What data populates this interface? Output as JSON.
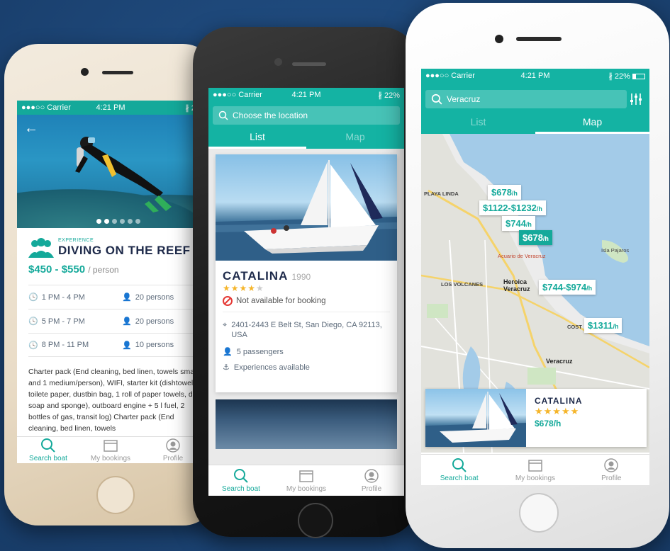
{
  "colors": {
    "accent": "#14b3a3",
    "title": "#1e2a4a",
    "star": "#f5b52a",
    "background": "#1d4677"
  },
  "status": {
    "carrier": "●●●○○ Carrier",
    "time": "4:21 PM",
    "battery": "22%",
    "battery_cut": "22"
  },
  "tabbar": {
    "search": "Search boat",
    "bookings": "My bookings",
    "profile": "Profile"
  },
  "phone1": {
    "experience_label": "EXPERIENCE",
    "title": "DIVING ON THE REEF",
    "price": "$450 - $550",
    "price_unit": "/ person",
    "schedule": [
      {
        "time": "1 PM - 4 PM",
        "persons": "20 persons"
      },
      {
        "time": "5 PM - 7 PM",
        "persons": "20 persons"
      },
      {
        "time": "8 PM - 11 PM",
        "persons": "10 persons"
      }
    ],
    "description": "Charter pack (End cleaning, bed linen, towels small and 1 medium/person), WIFI, starter kit (dishtowel, toilete paper, dustbin bag, 1 roll of paper towels, dish soap and sponge), outboard engine + 5 l fuel, 2 bottles of gas, transit log) Charter pack (End cleaning, bed linen, towels"
  },
  "phone2": {
    "search_placeholder": "Choose the location",
    "tabs": {
      "list": "List",
      "map": "Map"
    },
    "boat": {
      "name": "CATALINA",
      "year": "1990",
      "stars": 4,
      "availability": "Not available for booking",
      "address": "2401-2443 E Belt St, San Diego, CA 92113, USA",
      "passengers": "5 passengers",
      "experiences": "Experiences available"
    }
  },
  "phone3": {
    "search_value": "Veracruz",
    "tabs": {
      "list": "List",
      "map": "Map"
    },
    "map_prices": [
      {
        "label": "$678",
        "unit": "/h",
        "selected": false
      },
      {
        "label": "$1122-$1232",
        "unit": "/h",
        "selected": false
      },
      {
        "label": "$744",
        "unit": "/h",
        "selected": false
      },
      {
        "label": "$678",
        "unit": "/h",
        "selected": true
      },
      {
        "label": "$744-$974",
        "unit": "/h",
        "selected": false
      },
      {
        "label": "$1311",
        "unit": "/h",
        "selected": false
      }
    ],
    "map_labels": {
      "heroica": "Heroica",
      "veracruz_city": "Veracruz",
      "veracruz": "Veracruz",
      "acuario": "Acuario de Veracruz",
      "isla": "Isla Pajaros",
      "los_volcanes": "LOS VOLCANES",
      "playa_linda": "PLAYA LINDA",
      "cost": "COST"
    },
    "card": {
      "name": "CATALINA",
      "stars": 5,
      "price": "$678/h"
    }
  }
}
